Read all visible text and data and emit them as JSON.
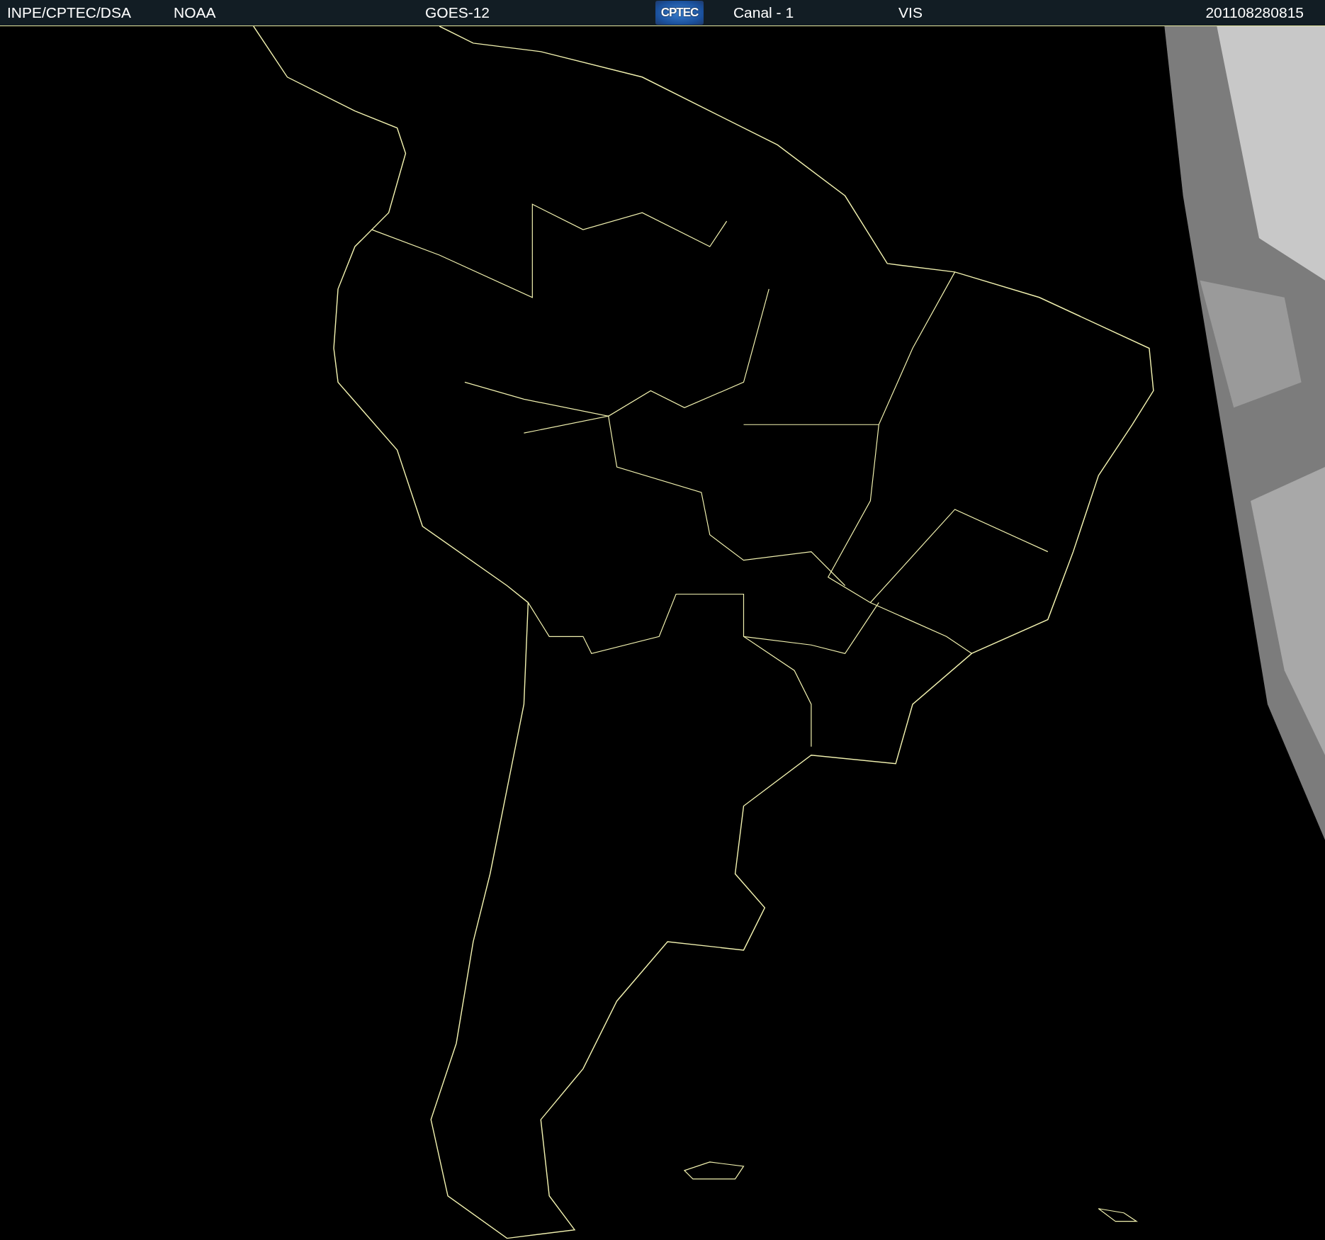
{
  "header": {
    "agency": "INPE/CPTEC/DSA",
    "source": "NOAA",
    "satellite": "GOES-12",
    "logo": "CPTEC",
    "channel": "Canal - 1",
    "band": "VIS",
    "timestamp": "201108280815"
  }
}
